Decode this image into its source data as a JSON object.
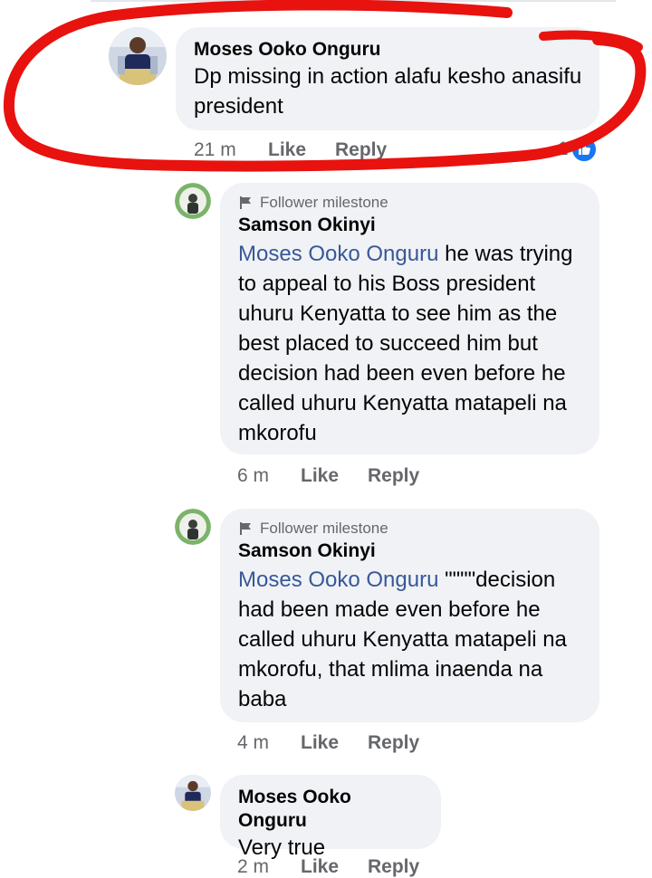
{
  "comments": [
    {
      "author": "Moses Ooko Onguru",
      "text": "Dp missing in action alafu kesho anasifu president",
      "time": "21 m",
      "like_label": "Like",
      "reply_label": "Reply",
      "reaction_count": "1",
      "reaction_icon": "thumbs-up-icon"
    },
    {
      "badge": "Follower milestone",
      "author": "Samson Okinyi",
      "mention": "Moses Ooko Onguru",
      "text": " he was trying to appeal to his Boss president uhuru Kenyatta to see him as the best placed to succeed him but decision had been even before he called uhuru Kenyatta matapeli na mkorofu",
      "time": "6 m",
      "like_label": "Like",
      "reply_label": "Reply"
    },
    {
      "badge": "Follower milestone",
      "author": "Samson Okinyi",
      "mention": "Moses Ooko Onguru",
      "text": " \"\"\"\"decision had been made even before he called uhuru Kenyatta matapeli na mkorofu, that mlima inaenda na baba",
      "time": "4 m",
      "like_label": "Like",
      "reply_label": "Reply"
    },
    {
      "author": "Moses Ooko Onguru",
      "text": "Very true",
      "time": "2 m",
      "like_label": "Like",
      "reply_label": "Reply"
    }
  ],
  "colors": {
    "bubble": "#f0f2f5",
    "mention": "#385898",
    "meta": "#65676b",
    "like_blue": "#1877f2",
    "annotation_red": "#e8120f"
  }
}
